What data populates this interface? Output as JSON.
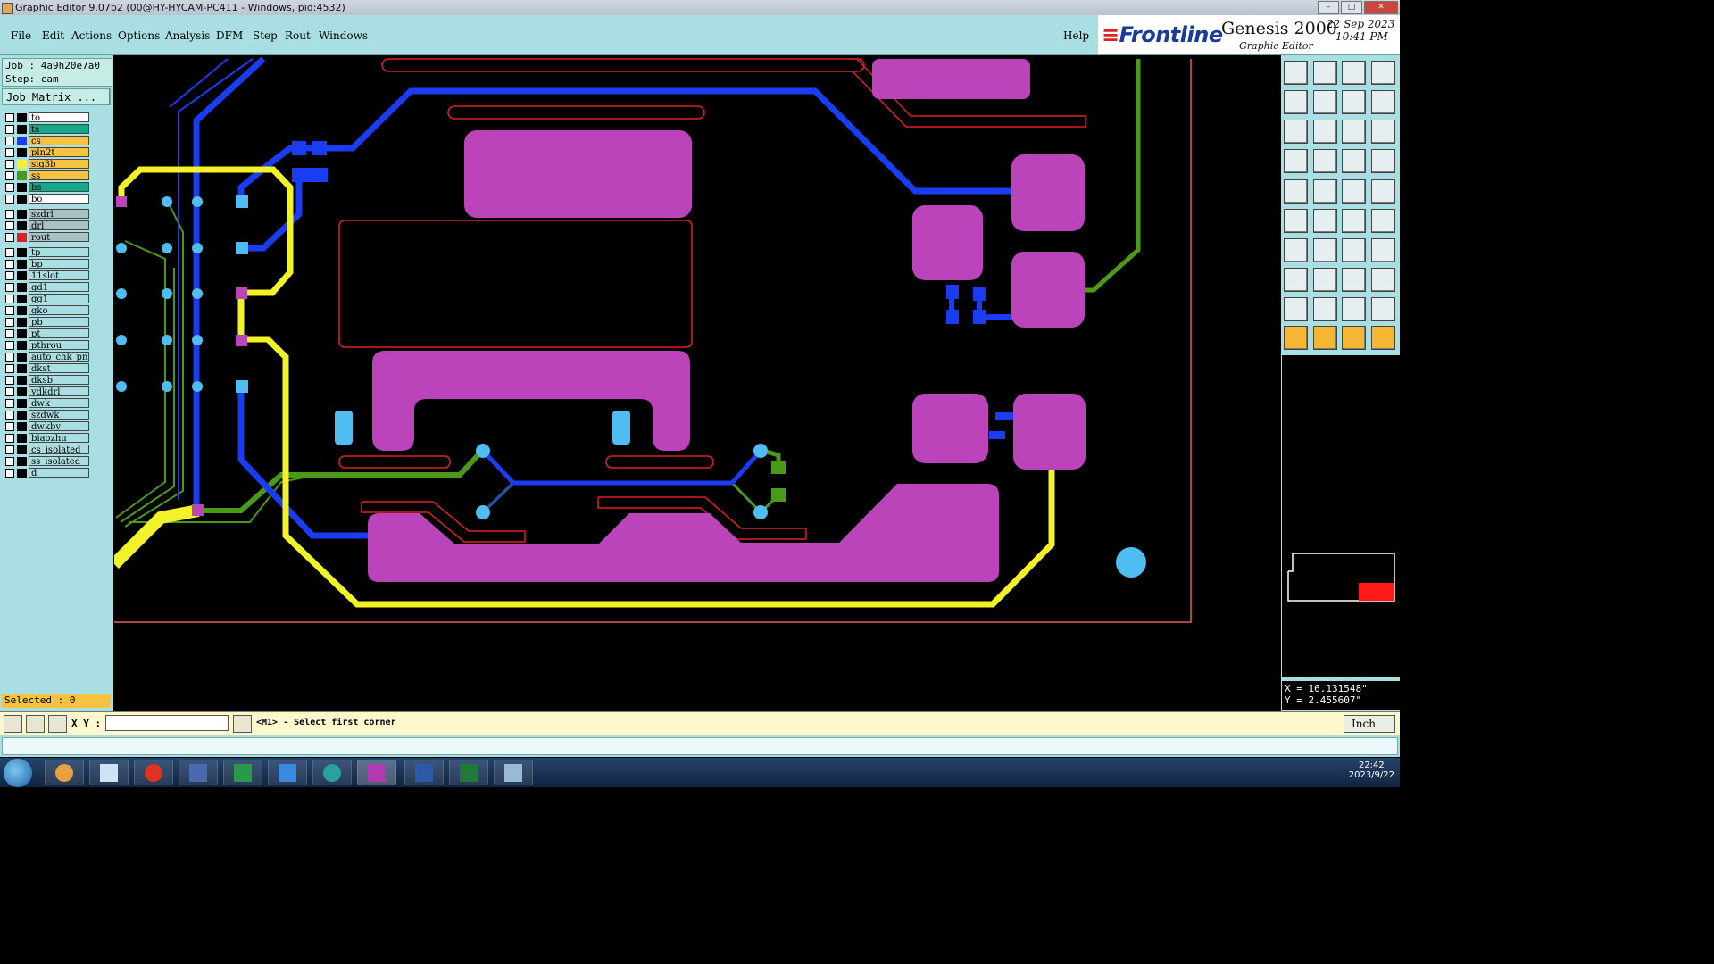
{
  "window": {
    "title": "Graphic Editor 9.07b2 (00@HY-HYCAM-PC411 - Windows, pid:4532)"
  },
  "menu": {
    "items": [
      "File",
      "Edit",
      "Actions",
      "Options",
      "Analysis",
      "DFM",
      "Step",
      "Rout",
      "Windows"
    ],
    "help": "Help"
  },
  "brand": {
    "logo": "Frontline",
    "product": "Genesis 2000",
    "subtitle": "Graphic Editor",
    "date": "22 Sep 2023",
    "time": "10:41 PM"
  },
  "job": {
    "job_label": "Job : 4a9h20e7a0",
    "step_label": "Step: cam",
    "matrix_button": "Job Matrix ..."
  },
  "layers": [
    {
      "name": "to",
      "color": "#ffffff",
      "swatch": "#000000"
    },
    {
      "name": "ts",
      "color": "#12a88a",
      "swatch": "#000000"
    },
    {
      "name": "cs",
      "color": "#f5c242",
      "swatch": "#1a3cf2"
    },
    {
      "name": "pln2t",
      "color": "#f5c242",
      "swatch": "#000000"
    },
    {
      "name": "sig3b",
      "color": "#f5c242",
      "swatch": "#f2f22a"
    },
    {
      "name": "ss",
      "color": "#f5c242",
      "swatch": "#4a9a18"
    },
    {
      "name": "bs",
      "color": "#12a88a",
      "swatch": "#000000"
    },
    {
      "name": "bo",
      "color": "#ffffff",
      "swatch": "#000000"
    },
    {
      "name": "szdrl",
      "color": "#a9c0c4",
      "swatch": "#000000"
    },
    {
      "name": "drl",
      "color": "#a9c0c4",
      "swatch": "#000000"
    },
    {
      "name": "rout",
      "color": "#a9c0c4",
      "swatch": "#e02020"
    },
    {
      "name": "tp",
      "color": "#a9dfe3",
      "swatch": "#000000"
    },
    {
      "name": "bp",
      "color": "#a9dfe3",
      "swatch": "#000000"
    },
    {
      "name": "11slot",
      "color": "#a9dfe3",
      "swatch": "#000000"
    },
    {
      "name": "gd1",
      "color": "#a9dfe3",
      "swatch": "#000000"
    },
    {
      "name": "gg1",
      "color": "#a9dfe3",
      "swatch": "#000000"
    },
    {
      "name": "gko",
      "color": "#a9dfe3",
      "swatch": "#000000"
    },
    {
      "name": "pb",
      "color": "#a9dfe3",
      "swatch": "#000000"
    },
    {
      "name": "pt",
      "color": "#a9dfe3",
      "swatch": "#000000"
    },
    {
      "name": "pthrou",
      "color": "#a9dfe3",
      "swatch": "#000000"
    },
    {
      "name": "auto_chk_pn",
      "color": "#a9dfe3",
      "swatch": "#000000"
    },
    {
      "name": "dkst",
      "color": "#a9dfe3",
      "swatch": "#000000"
    },
    {
      "name": "dksb",
      "color": "#a9dfe3",
      "swatch": "#000000"
    },
    {
      "name": "ydkdrl",
      "color": "#a9dfe3",
      "swatch": "#000000"
    },
    {
      "name": "dwk",
      "color": "#a9dfe3",
      "swatch": "#000000"
    },
    {
      "name": "szdwk",
      "color": "#a9dfe3",
      "swatch": "#000000"
    },
    {
      "name": "dwkby",
      "color": "#a9dfe3",
      "swatch": "#000000"
    },
    {
      "name": "biaozhu",
      "color": "#a9dfe3",
      "swatch": "#000000"
    },
    {
      "name": "cs_isolated",
      "color": "#a9dfe3",
      "swatch": "#000000"
    },
    {
      "name": "ss_isolated",
      "color": "#a9dfe3",
      "swatch": "#000000"
    },
    {
      "name": "d",
      "color": "#a9dfe3",
      "swatch": "#000000"
    }
  ],
  "selected": "Selected : 0",
  "coords": {
    "x": "X = 16.131548\"",
    "y": "Y = 2.455607\""
  },
  "command": {
    "xy_label": "X Y :",
    "input_value": "",
    "prompt": "<M1> - Select first corner",
    "unit": "Inch"
  },
  "tray": {
    "time": "22:42",
    "date": "2023/9/22"
  }
}
